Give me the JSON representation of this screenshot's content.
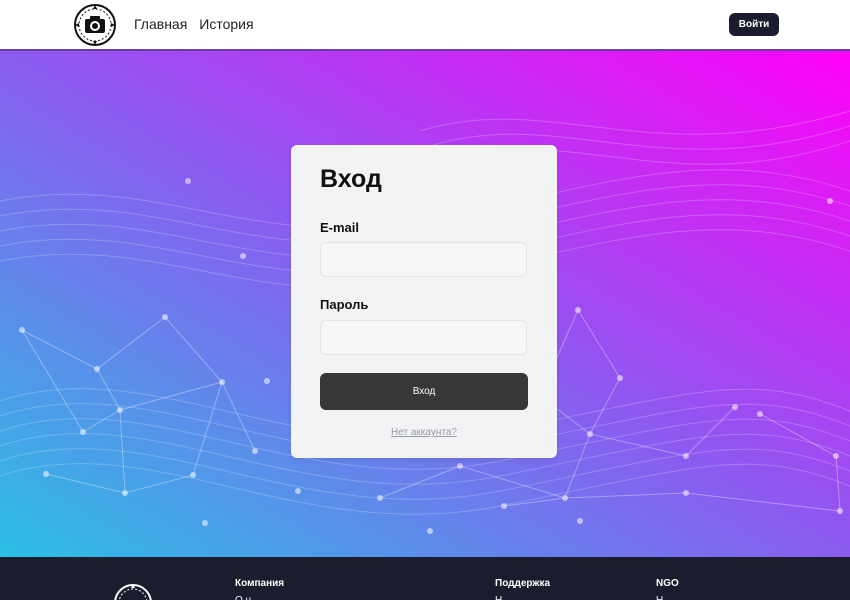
{
  "header": {
    "nav": [
      {
        "label": "Главная"
      },
      {
        "label": "История"
      }
    ],
    "login_button": "Войти"
  },
  "login_card": {
    "title": "Вход",
    "email_label": "E-mail",
    "email_value": "",
    "password_label": "Пароль",
    "password_value": "",
    "submit_label": "Вход",
    "signup_link": "Нет аккаунта?"
  },
  "footer": {
    "columns": [
      {
        "title": "Компания",
        "first_item": "О н"
      },
      {
        "title": "Поддержка",
        "first_item": "Н"
      },
      {
        "title": "NGO",
        "first_item": "Н"
      }
    ]
  },
  "colors": {
    "header_bg": "#ffffff",
    "dark": "#1b1c2e",
    "gradient_start": "#2bc0e4",
    "gradient_mid": "#8a5cf0",
    "gradient_end": "#ff00f7",
    "card_bg": "#f2f3f5",
    "submit_bg": "#373737"
  }
}
